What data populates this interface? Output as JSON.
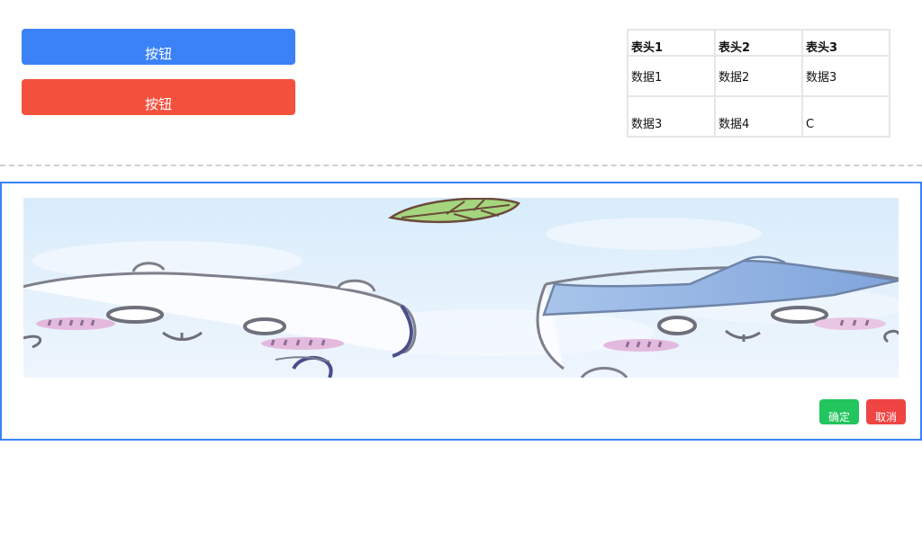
{
  "buttons": {
    "primary_label": "按钮",
    "danger_label": "按钮"
  },
  "table": {
    "headers": [
      "表头1",
      "表头2",
      "表头3"
    ],
    "rows": [
      [
        "数据1",
        "数据2",
        "数据3"
      ],
      [
        "数据3",
        "数据4",
        "C"
      ]
    ]
  },
  "dialog": {
    "confirm_label": "确定",
    "cancel_label": "取消"
  },
  "colors": {
    "primary": "#3b82f6",
    "danger": "#f4513d",
    "confirm": "#22c55e",
    "cancel": "#ef4444"
  },
  "image": {
    "icon": "cartoon-banner-image"
  }
}
